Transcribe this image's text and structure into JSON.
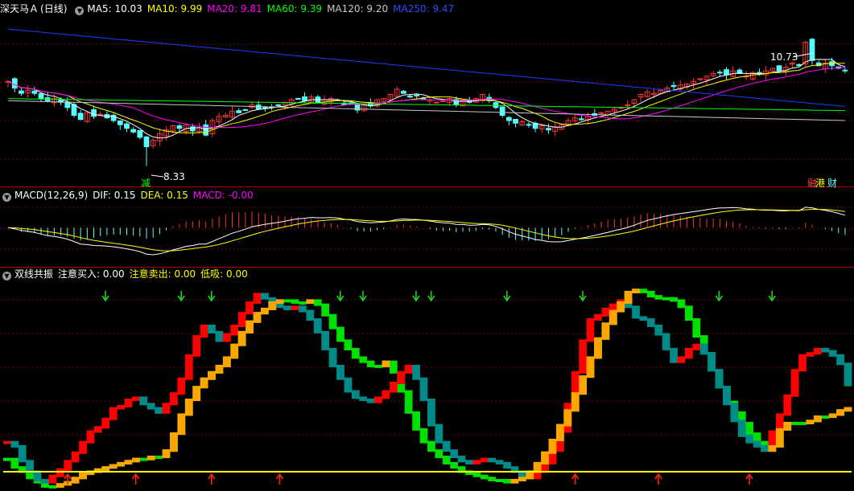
{
  "colors": {
    "bg": "#000000",
    "divider": "#b00000",
    "grid": "#7a0000",
    "up": "#ff3232",
    "down": "#54ffff",
    "ma5": "#ffffff",
    "ma10": "#ffff00",
    "ma20": "#ff00ff",
    "ma60": "#00ff00",
    "ma120": "#c8c8c8",
    "ma250": "#1e3cff",
    "dif": "#ffffff",
    "dea": "#ffff00",
    "bar_red": "#ff0000",
    "bar_green": "#00e000",
    "bar_orange": "#ffa500",
    "bar_teal": "#008b8b",
    "level_line": "#ffff00",
    "buy_arrow": "#ff2020",
    "sell_arrow": "#20d020"
  },
  "header": {
    "stock_name": "深天马Ａ",
    "period": "(日线)",
    "ma5_label": "MA5: 10.03",
    "ma10_label": "MA10: 9.99",
    "ma20_label": "MA20: 9.81",
    "ma60_label": "MA60: 9.39",
    "ma120_label": "MA120: 9.20",
    "ma250_label": "MA250: 9.47"
  },
  "macd_header": {
    "title": "MACD(12,26,9)",
    "dif_label": "DIF: 0.15",
    "dea_label": "DEA: 0.15",
    "macd_label": "MACD: -0.00"
  },
  "osc_header": {
    "title": "双线共振",
    "buy_label": "注意买入: 0.00",
    "sell_label": "注意卖出: 0.00",
    "low_label": "低吸: 0.00"
  },
  "annotations": {
    "high_label": "10.73",
    "low_label": "8.33",
    "left_marker": "减",
    "right_marker_1": "融",
    "right_marker_2": "港",
    "right_marker_3": "财"
  },
  "chart_data": [
    {
      "type": "candlestick",
      "title": "深天马Ａ (日线)",
      "ylim": [
        8.0,
        11.2
      ],
      "price_high": 10.73,
      "price_low": 8.33,
      "closes": [
        9.95,
        9.82,
        9.72,
        9.78,
        9.72,
        9.62,
        9.58,
        9.62,
        9.55,
        9.45,
        9.3,
        9.22,
        9.35,
        9.28,
        9.32,
        9.25,
        9.2,
        9.12,
        9.05,
        8.98,
        8.88,
        8.7,
        8.82,
        8.95,
        9.02,
        9.1,
        9.05,
        9.12,
        9.0,
        9.06,
        8.92,
        9.2,
        9.28,
        9.3,
        9.38,
        9.35,
        9.4,
        9.5,
        9.42,
        9.45,
        9.45,
        9.5,
        9.55,
        9.6,
        9.62,
        9.58,
        9.65,
        9.55,
        9.6,
        9.62,
        9.58,
        9.5,
        9.52,
        9.4,
        9.5,
        9.48,
        9.6,
        9.62,
        9.7,
        9.8,
        9.72,
        9.65,
        9.68,
        9.62,
        9.6,
        9.55,
        9.58,
        9.62,
        9.5,
        9.6,
        9.55,
        9.62,
        9.7,
        9.58,
        9.45,
        9.3,
        9.2,
        9.15,
        9.18,
        9.12,
        9.05,
        9.1,
        9.02,
        9.08,
        9.12,
        9.2,
        9.25,
        9.22,
        9.28,
        9.3,
        9.35,
        9.38,
        9.42,
        9.45,
        9.5,
        9.6,
        9.7,
        9.75,
        9.72,
        9.78,
        9.82,
        9.85,
        9.88,
        9.9,
        9.95,
        10.0,
        10.05,
        10.1,
        10.12,
        10.08,
        10.15,
        10.1,
        10.05,
        10.12,
        10.08,
        10.15,
        10.2,
        10.15,
        10.22,
        10.3,
        10.25,
        10.7,
        10.35,
        10.25,
        10.3,
        10.25,
        10.2,
        10.15
      ],
      "ma5": 10.03,
      "ma10": 9.99,
      "ma20": 9.81,
      "ma60": 9.39,
      "ma120": 9.2,
      "ma250": 9.47,
      "series": [
        {
          "name": "MA5",
          "values": []
        },
        {
          "name": "MA10",
          "values": []
        },
        {
          "name": "MA20",
          "values": []
        },
        {
          "name": "MA60",
          "values": []
        },
        {
          "name": "MA120",
          "values": []
        },
        {
          "name": "MA250",
          "values": []
        }
      ]
    },
    {
      "type": "macd",
      "title": "MACD(12,26,9)",
      "dif": 0.15,
      "dea": 0.15,
      "macd": -0.0,
      "ylim": [
        -0.35,
        0.25
      ]
    },
    {
      "type": "oscillator",
      "title": "双线共振",
      "buy": 0.0,
      "sell": 0.0,
      "low_buy": 0.0,
      "ylim": [
        0,
        100
      ],
      "level": 8,
      "line1": [
        22,
        20,
        13,
        8,
        4,
        3,
        6,
        9,
        13,
        17,
        22,
        27,
        29,
        33,
        38,
        39,
        42,
        43,
        40,
        38,
        36,
        40,
        45,
        52,
        63,
        72,
        77,
        74,
        70,
        73,
        77,
        83,
        88,
        92,
        90,
        87,
        86,
        85,
        86,
        84,
        80,
        74,
        66,
        58,
        52,
        46,
        43,
        42,
        41,
        43,
        46,
        50,
        55,
        58,
        52,
        42,
        30,
        22,
        18,
        15,
        13,
        12,
        13,
        14,
        13,
        12,
        10,
        8,
        6,
        5,
        8,
        12,
        18,
        27,
        40,
        55,
        70,
        80,
        82,
        85,
        87,
        89,
        86,
        81,
        80,
        77,
        73,
        66,
        60,
        62,
        66,
        68,
        64,
        56,
        48,
        40,
        32,
        25,
        22,
        20,
        18,
        27,
        35,
        44,
        56,
        63,
        64,
        66,
        65,
        63,
        59,
        49
      ],
      "line2": [
        14,
        10,
        8,
        5,
        3,
        1,
        1,
        2,
        3,
        5,
        7,
        8,
        9,
        10,
        11,
        12,
        13,
        14,
        14,
        15,
        15,
        18,
        26,
        35,
        42,
        48,
        52,
        55,
        58,
        62,
        68,
        74,
        79,
        83,
        85,
        88,
        89,
        89,
        88,
        88,
        89,
        87,
        82,
        76,
        70,
        66,
        62,
        60,
        58,
        58,
        60,
        55,
        46,
        36,
        28,
        22,
        18,
        15,
        12,
        10,
        8,
        7,
        6,
        5,
        4,
        4,
        3,
        4,
        5,
        8,
        12,
        17,
        23,
        30,
        37,
        45,
        53,
        62,
        71,
        78,
        84,
        88,
        93,
        94,
        93,
        91,
        90,
        90,
        89,
        86,
        80,
        72,
        64,
        56,
        48,
        41,
        36,
        31,
        26,
        22,
        18,
        20,
        28,
        31,
        31,
        31,
        32,
        34,
        34,
        35,
        37,
        38
      ],
      "buy_signals": [
        8,
        17,
        27,
        36,
        75,
        86,
        98,
        124
      ],
      "sell_signals": [
        13,
        23,
        27,
        44,
        47,
        54,
        56,
        66,
        76,
        94,
        101,
        127,
        132
      ]
    }
  ]
}
